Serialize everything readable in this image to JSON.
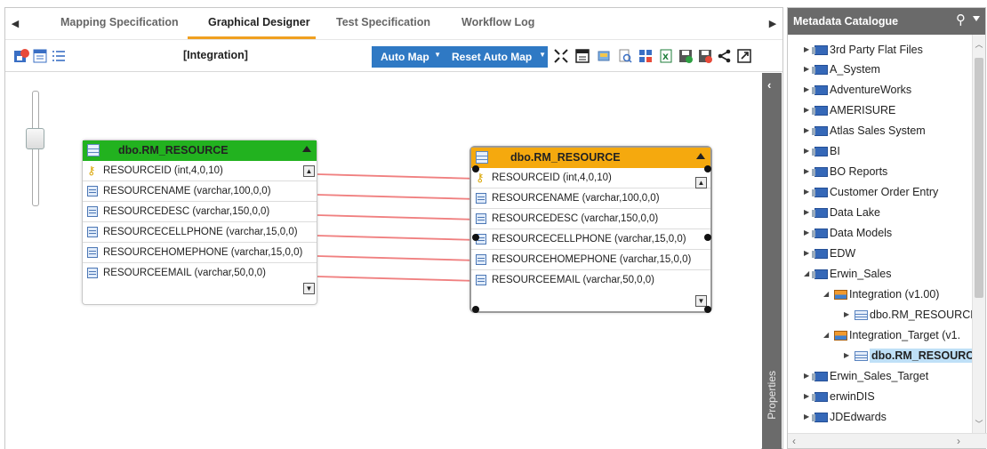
{
  "tabs": [
    {
      "label": "Mapping Specification",
      "active": false
    },
    {
      "label": "Graphical Designer",
      "active": true
    },
    {
      "label": "Test Specification",
      "active": false
    },
    {
      "label": "Workflow Log",
      "active": false
    }
  ],
  "toolbar": {
    "title": "[Integration]",
    "auto_map_label": "Auto Map",
    "reset_auto_map_label": "Reset Auto Map"
  },
  "source_table": {
    "name": "dbo.RM_RESOURCE",
    "header_color": "#22b21f",
    "columns": [
      {
        "label": "RESOURCEID (int,4,0,10)",
        "icon": "key-icon"
      },
      {
        "label": "RESOURCENAME (varchar,100,0,0)",
        "icon": "column-icon"
      },
      {
        "label": "RESOURCEDESC (varchar,150,0,0)",
        "icon": "column-icon"
      },
      {
        "label": "RESOURCECELLPHONE (varchar,15,0,0)",
        "icon": "column-icon"
      },
      {
        "label": "RESOURCEHOMEPHONE (varchar,15,0,0)",
        "icon": "column-icon"
      },
      {
        "label": "RESOURCEEMAIL (varchar,50,0,0)",
        "icon": "column-icon"
      }
    ]
  },
  "target_table": {
    "name": "dbo.RM_RESOURCE",
    "header_color": "#f5a90e",
    "columns": [
      {
        "label": "RESOURCEID (int,4,0,10)",
        "icon": "key-icon"
      },
      {
        "label": "RESOURCENAME (varchar,100,0,0)",
        "icon": "column-icon"
      },
      {
        "label": "RESOURCEDESC (varchar,150,0,0)",
        "icon": "column-icon"
      },
      {
        "label": "RESOURCECELLPHONE (varchar,15,0,0)",
        "icon": "column-icon"
      },
      {
        "label": "RESOURCEHOMEPHONE (varchar,15,0,0)",
        "icon": "column-icon"
      },
      {
        "label": "RESOURCEEMAIL (varchar,50,0,0)",
        "icon": "column-icon"
      }
    ]
  },
  "mapping_line_color": "#f08080",
  "properties_label": "Properties",
  "catalogue": {
    "title": "Metadata Catalogue",
    "nodes": [
      {
        "label": "3rd Party Flat Files",
        "icon": "database-icon",
        "level": 0,
        "expanded": false
      },
      {
        "label": "A_System",
        "icon": "database-icon",
        "level": 0,
        "expanded": false
      },
      {
        "label": "AdventureWorks",
        "icon": "database-icon",
        "level": 0,
        "expanded": false
      },
      {
        "label": "AMERISURE",
        "icon": "database-icon",
        "level": 0,
        "expanded": false
      },
      {
        "label": "Atlas Sales System",
        "icon": "database-icon",
        "level": 0,
        "expanded": false
      },
      {
        "label": "BI",
        "icon": "database-icon",
        "level": 0,
        "expanded": false
      },
      {
        "label": "BO Reports",
        "icon": "database-icon",
        "level": 0,
        "expanded": false
      },
      {
        "label": "Customer Order Entry",
        "icon": "database-icon",
        "level": 0,
        "expanded": false
      },
      {
        "label": "Data Lake",
        "icon": "database-icon",
        "level": 0,
        "expanded": false
      },
      {
        "label": "Data Models",
        "icon": "database-icon",
        "level": 0,
        "expanded": false
      },
      {
        "label": "EDW",
        "icon": "database-icon",
        "level": 0,
        "expanded": false
      },
      {
        "label": "Erwin_Sales",
        "icon": "database-icon",
        "level": 0,
        "expanded": true
      },
      {
        "label": "Integration (v1.00)",
        "icon": "model-icon",
        "level": 1,
        "expanded": true
      },
      {
        "label": "dbo.RM_RESOURCE",
        "icon": "table-icon",
        "level": 2,
        "expanded": false
      },
      {
        "label": "Integration_Target (v1.",
        "icon": "model-icon",
        "level": 1,
        "expanded": true
      },
      {
        "label": "dbo.RM_RESOURCE",
        "icon": "table-icon",
        "level": 2,
        "expanded": false,
        "selected": true
      },
      {
        "label": "Erwin_Sales_Target",
        "icon": "database-icon",
        "level": 0,
        "expanded": false
      },
      {
        "label": "erwinDIS",
        "icon": "database-icon",
        "level": 0,
        "expanded": false
      },
      {
        "label": "JDEdwards",
        "icon": "database-icon",
        "level": 0,
        "expanded": false
      }
    ]
  }
}
